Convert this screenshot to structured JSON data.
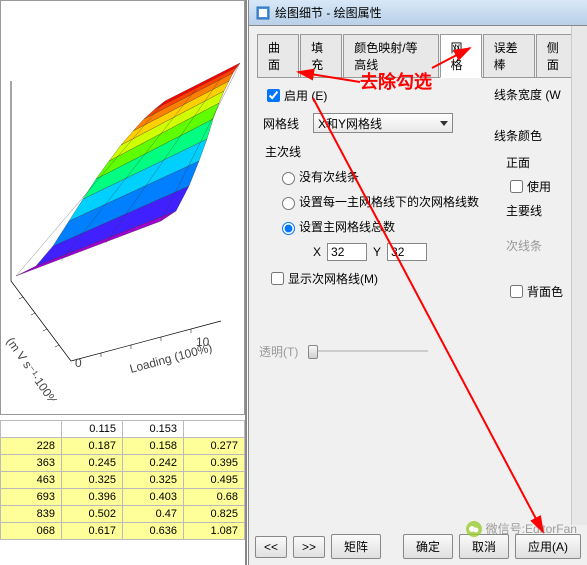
{
  "window": {
    "title": "绘图细节 - 绘图属性"
  },
  "annotation": {
    "text": "去除勾选"
  },
  "tabs": {
    "items": [
      "曲面",
      "填充",
      "颜色映射/等高线",
      "网格",
      "误差棒",
      "侧面"
    ],
    "active_index": 3
  },
  "grid_tab": {
    "enable_label": "启用 (E)",
    "enable_checked": true,
    "gridline_label": "网格线",
    "gridline_select": "X和Y网格线",
    "line_width_label": "线条宽度 (W",
    "main_lines_label": "主次线",
    "line_color_label": "线条颜色",
    "radio1": "没有次线条",
    "radio2": "设置每一主网格线下的次网格线数",
    "radio3": "设置主网格线总数",
    "radio_selected": 3,
    "x_label": "X",
    "x_value": "32",
    "y_label": "Y",
    "y_value": "32",
    "show_sub_label": "显示次网格线(M)",
    "front_label": "正面",
    "use_label": "使用",
    "main_line_label": "主要线",
    "sub_line_style_label": "次线条",
    "back_color_label": "背面色",
    "transparent_label": "透明(T)"
  },
  "buttons": {
    "prev": "<<",
    "next": ">>",
    "matrix": "矩阵",
    "ok": "确定",
    "cancel": "取消",
    "apply": "应用(A)"
  },
  "plot": {
    "x_axis": "Loading (100%)",
    "y_axis": "(m·s⁻¹ · 100%)"
  },
  "table": {
    "rows": [
      [
        "",
        "0.115",
        "0.153",
        ""
      ],
      [
        "228",
        "0.187",
        "0.158",
        "0.277"
      ],
      [
        "363",
        "0.245",
        "0.242",
        "0.395"
      ],
      [
        "463",
        "0.325",
        "0.325",
        "0.495"
      ],
      [
        "693",
        "0.396",
        "0.403",
        "0.68"
      ],
      [
        "839",
        "0.502",
        "0.47",
        "0.825"
      ],
      [
        "068",
        "0.617",
        "0.636",
        "1.087"
      ]
    ]
  },
  "watermark": {
    "text": "微信号:EditorFan"
  },
  "chart_data": {
    "type": "surface",
    "title": "",
    "xlabel": "Loading (100%)",
    "ylabel": "",
    "x_range": [
      0,
      10
    ],
    "y_range": [
      0,
      10
    ],
    "z_range": [
      0,
      1.1
    ],
    "colormap": "rainbow",
    "note": "3D rainbow surface plot; approximate z ascending from ~0.1 (front-left, blue/purple) to ~1.1 (back-right, red)"
  }
}
